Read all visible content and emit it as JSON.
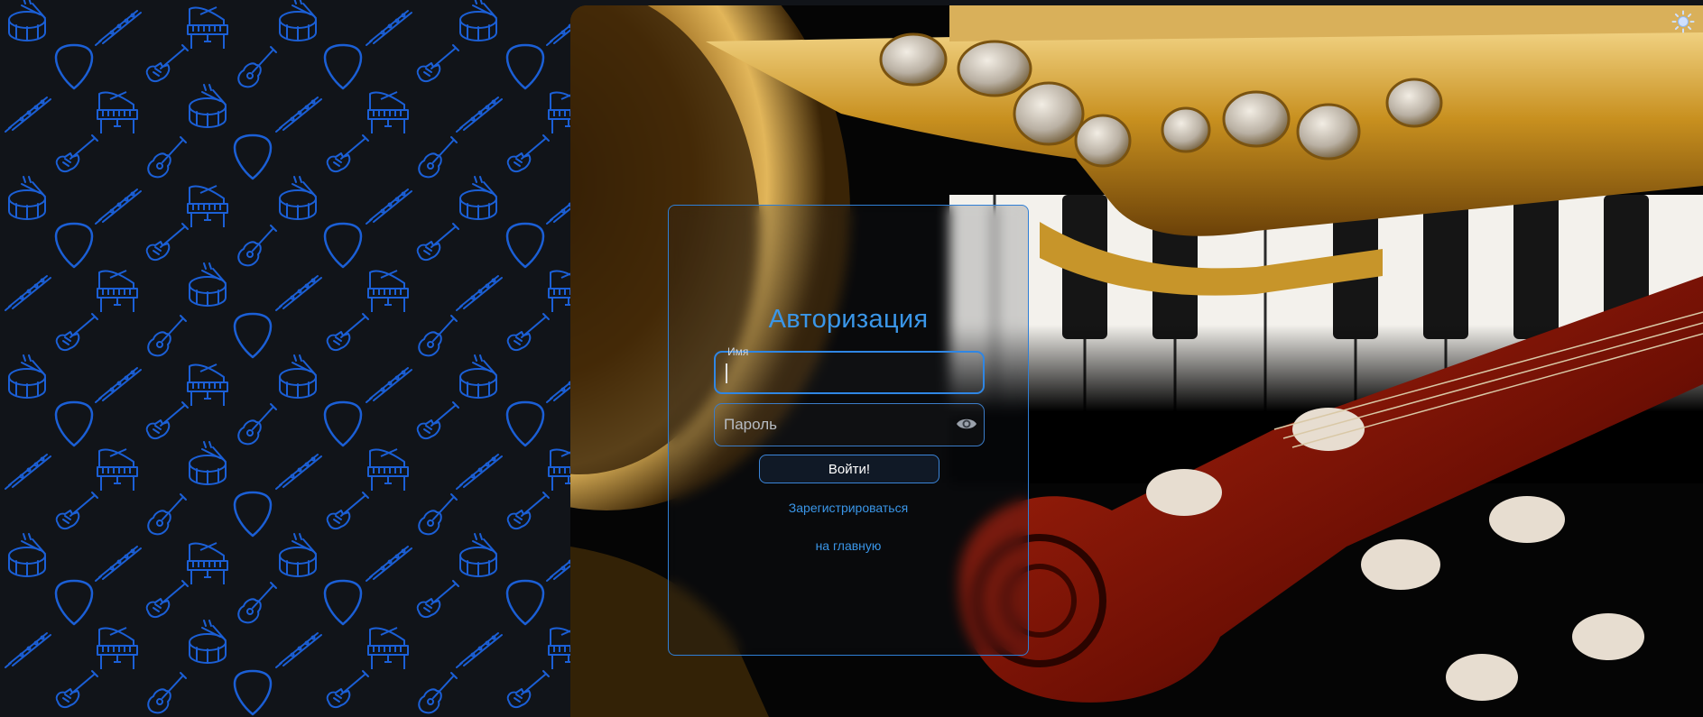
{
  "colors": {
    "accent": "#3a96e8",
    "pattern_icon": "#1b5fd6",
    "panel_bg": "#111419"
  },
  "pattern": {
    "icons": [
      "drum-icon",
      "flute-icon",
      "piano-icon",
      "guitar-pick-icon",
      "electric-guitar-icon",
      "acoustic-guitar-icon"
    ]
  },
  "background_photo": {
    "subject": "saxophone-piano-violin-photo"
  },
  "theme_toggle": {
    "icon": "sun-icon"
  },
  "login": {
    "title": "Авторизация",
    "name_field": {
      "label": "Имя",
      "value": ""
    },
    "password_field": {
      "placeholder": "Пароль",
      "icon": "eye-icon"
    },
    "submit_label": "Войти!",
    "register_link": "Зарегистрироваться",
    "home_link": "на главную"
  }
}
